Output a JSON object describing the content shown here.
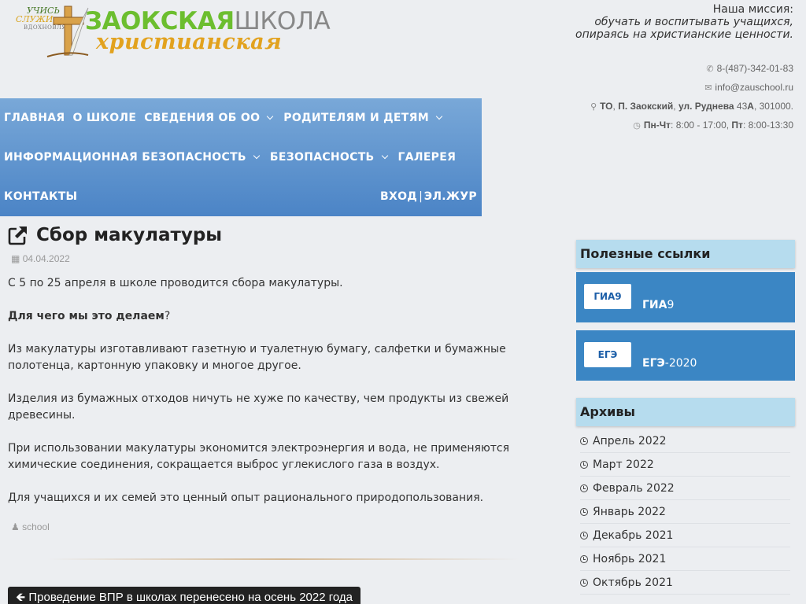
{
  "logo": {
    "small_line1": "УЧИСЬ",
    "small_line2": "СЛУЖИ",
    "small_line3": "ВДОХНОВЛЯЙ",
    "title_part1": "ЗАОКСКАЯ",
    "title_part2": "ШКОЛА",
    "subtitle": "христианская",
    "colors": {
      "green": "#6cbe2f",
      "gold": "#e2a21e",
      "gray": "#888888"
    }
  },
  "mission": {
    "title": "Наша миссия:",
    "line1": "обучать и воспитывать учащихся,",
    "line2": "опираясь на христианские ценности."
  },
  "contacts": {
    "phone": "8-(487)-342-01-83",
    "email": "info@zauschool.ru",
    "address_b1": "ТО",
    "address_t1": ", ",
    "address_b2": "П. Заокский",
    "address_t2": ", ",
    "address_b3": "ул. Руднева",
    "address_t3": " 43",
    "address_b4": "А",
    "address_t4": ", 301000.",
    "hours_b1": "Пн-Чт",
    "hours_t1": ": 8:00 - 17:00, ",
    "hours_b2": "Пт",
    "hours_t2": ": 8:00-13:30",
    "icons": [
      "phone-icon",
      "envelope-icon",
      "map-marker-icon",
      "clock-icon"
    ]
  },
  "nav": {
    "items": [
      {
        "label": "ГЛАВНАЯ",
        "dropdown": false
      },
      {
        "label": "О ШКОЛЕ",
        "dropdown": false
      },
      {
        "label": "СВЕДЕНИЯ ОБ ОО",
        "dropdown": true
      },
      {
        "label": "РОДИТЕЛЯМ И ДЕТЯМ",
        "dropdown": true
      },
      {
        "label": "ИНФОРМАЦИОННАЯ БЕЗОПАСНОСТЬ",
        "dropdown": true
      },
      {
        "label": "БЕЗОПАСНОСТЬ",
        "dropdown": true
      },
      {
        "label": "ГАЛЕРЕЯ",
        "dropdown": false
      },
      {
        "label": "КОНТАКТЫ",
        "dropdown": false
      }
    ],
    "login": "ВХОД",
    "separator": "|",
    "journal": "ЭЛ.ЖУР",
    "color": "#4b84c6"
  },
  "article": {
    "title": "Сбор макулатуры",
    "date": "04.04.2022",
    "p1": "С 5 по 25 апреля в школе проводится сбора макулатуры.",
    "p2_bold": "Для чего мы это делаем",
    "p2_rest": "?",
    "p3": "Из макулатуры изготавливают газетную и туалетную бумагу, салфетки и бумажные полотенца, картонную упаковку и многое другое.",
    "p4": "Изделия из бумажных отходов ничуть не хуже по качеству, чем продукты из свежей древесины.",
    "p5": "При использовании макулатуры экономится электроэнергия и вода, не применяются химические соединения, сокращается выброс углекислого газа в воздух.",
    "p6": "Для учащихся и их семей это ценный опыт рационального природопользования.",
    "author": "school",
    "prev_link": "Проведение ВПР в школах перенесено на осень 2022 года"
  },
  "sidebar": {
    "links_title": "Полезные ссылки",
    "links": [
      {
        "logo": "ГИА9",
        "bold": "ГИА",
        "rest": "9"
      },
      {
        "logo": "ЕГЭ",
        "bold": "ЕГЭ",
        "rest": "-2020"
      }
    ],
    "archive_title": "Архивы",
    "archive": [
      "Апрель 2022",
      "Март 2022",
      "Февраль 2022",
      "Январь 2022",
      "Декабрь 2021",
      "Ноябрь 2021",
      "Октябрь 2021"
    ]
  }
}
